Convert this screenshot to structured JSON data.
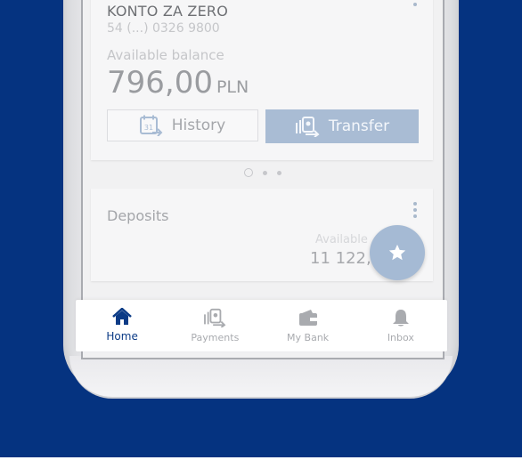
{
  "account": {
    "name": "KONTO ZA ZERO",
    "number": "54 (...) 0326 9800",
    "balance_label": "Available balance",
    "balance_amount": "796,00",
    "balance_currency": "PLN",
    "history_label": "History",
    "transfer_label": "Transfer",
    "calendar_day": "31"
  },
  "pager": {
    "count": 3,
    "active_index": 0
  },
  "deposits": {
    "title": "Deposits",
    "available_label": "Available",
    "amount": "11 122,"
  },
  "bottom_nav": {
    "items": [
      {
        "label": "Home",
        "icon": "home-icon",
        "active": true
      },
      {
        "label": "Payments",
        "icon": "payments-icon",
        "active": false
      },
      {
        "label": "My Bank",
        "icon": "wallet-icon",
        "active": false
      },
      {
        "label": "Inbox",
        "icon": "bell-icon",
        "active": false
      }
    ]
  },
  "colors": {
    "background": "#053380",
    "accent": "#0b3b86",
    "transfer_button": "#a9bcd4",
    "fab": "#a5bad4"
  }
}
